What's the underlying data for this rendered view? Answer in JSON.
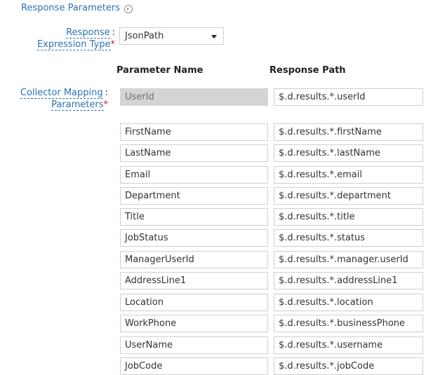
{
  "section": {
    "title": "Response Parameters"
  },
  "response_expression": {
    "label_line1": "Response",
    "label_line2": "Expression Type",
    "required_mark": "*",
    "selected_value": "JsonPath"
  },
  "collector_mapping": {
    "label_line1": "Collector Mapping",
    "label_line2": "Parameters",
    "required_mark": "*"
  },
  "table": {
    "headers": {
      "name": "Parameter Name",
      "path": "Response Path"
    },
    "rows": [
      {
        "name": "UserId",
        "path": "$.d.results.*.userId",
        "disabled": true
      },
      {
        "name": "FirstName",
        "path": "$.d.results.*.firstName"
      },
      {
        "name": "LastName",
        "path": "$.d.results.*.lastName"
      },
      {
        "name": "Email",
        "path": "$.d.results.*.email"
      },
      {
        "name": "Department",
        "path": "$.d.results.*.department"
      },
      {
        "name": "Title",
        "path": "$.d.results.*.title"
      },
      {
        "name": "JobStatus",
        "path": "$.d.results.*.status"
      },
      {
        "name": "ManagerUserId",
        "path": "$.d.results.*.manager.userId"
      },
      {
        "name": "AddressLine1",
        "path": "$.d.results.*.addressLine1"
      },
      {
        "name": "Location",
        "path": "$.d.results.*.location"
      },
      {
        "name": "WorkPhone",
        "path": "$.d.results.*.businessPhone"
      },
      {
        "name": "UserName",
        "path": "$.d.results.*.username"
      },
      {
        "name": "JobCode",
        "path": "$.d.results.*.jobCode"
      }
    ]
  },
  "icons": {
    "help": "help-circle-arrow-icon",
    "dropdown": "chevron-down-icon"
  }
}
